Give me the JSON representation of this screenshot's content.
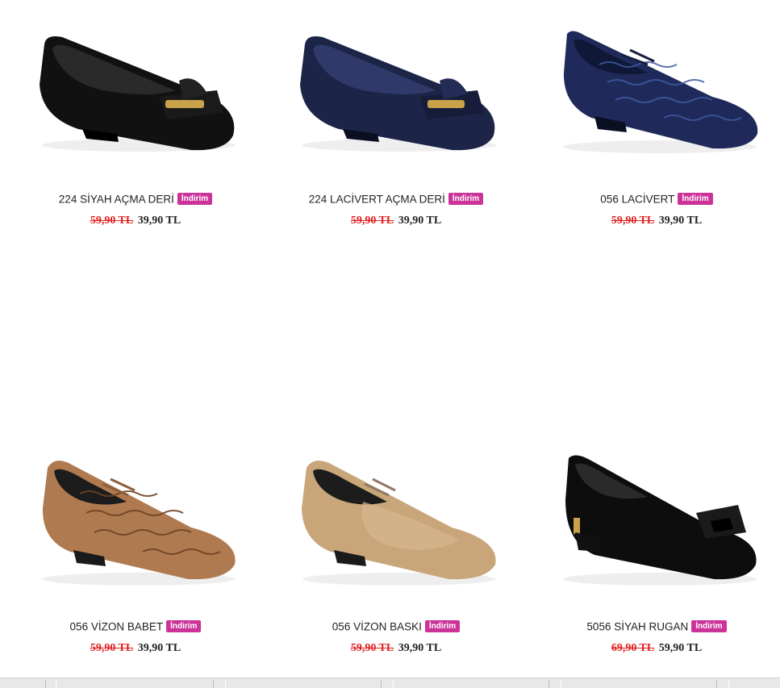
{
  "products": [
    {
      "name": "224 SİYAH AÇMA DERİ",
      "badge": "İndirim",
      "old_price": "59,90 TL",
      "new_price": "39,90 TL",
      "image": "black-patent-loafer-flat"
    },
    {
      "name": "224 LACİVERT AÇMA DERİ",
      "badge": "İndirim",
      "old_price": "59,90 TL",
      "new_price": "39,90 TL",
      "image": "navy-patent-loafer-flat"
    },
    {
      "name": "056 LACİVERT",
      "badge": "İndirim",
      "old_price": "59,90 TL",
      "new_price": "39,90 TL",
      "image": "navy-croc-lace-up"
    },
    {
      "name": "056 VİZON BABET",
      "badge": "İndirim",
      "old_price": "59,90 TL",
      "new_price": "39,90 TL",
      "image": "mink-croc-lace-up"
    },
    {
      "name": "056 VİZON BASKI",
      "badge": "İndirim",
      "old_price": "59,90 TL",
      "new_price": "39,90 TL",
      "image": "mink-printed-lace-up"
    },
    {
      "name": "5056 SİYAH RUGAN",
      "badge": "İndirim",
      "old_price": "69,90 TL",
      "new_price": "59,90 TL",
      "image": "black-patent-bow-flat"
    }
  ],
  "colors": {
    "badge": "#cc3399",
    "old_price": "#e02020",
    "text": "#222222"
  }
}
